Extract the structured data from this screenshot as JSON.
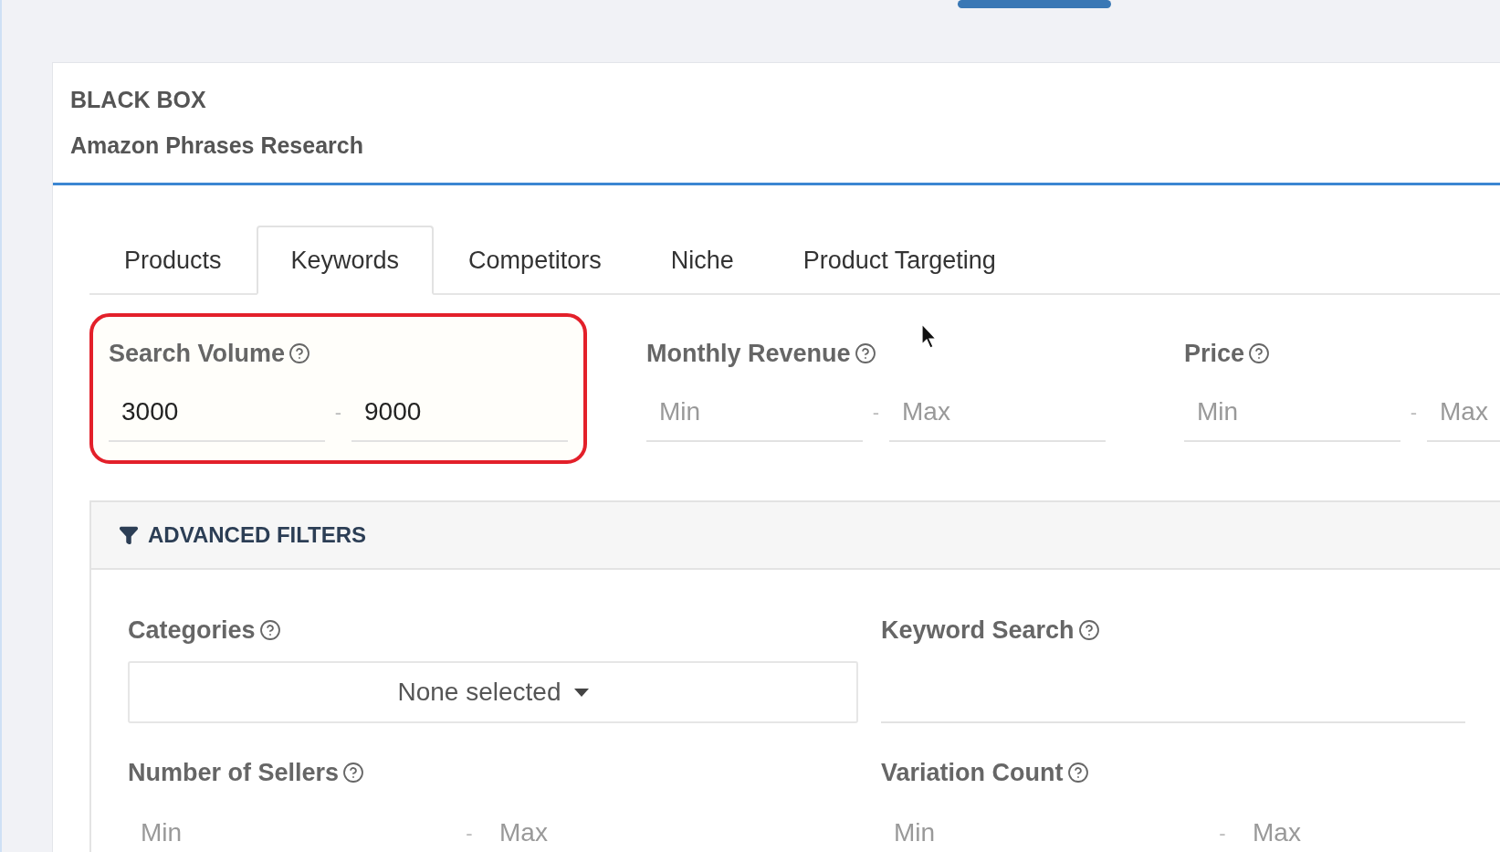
{
  "header": {
    "title": "BLACK BOX",
    "subtitle": "Amazon Phrases Research"
  },
  "tabs": [
    {
      "label": "Products",
      "selected": false
    },
    {
      "label": "Keywords",
      "selected": true
    },
    {
      "label": "Competitors",
      "selected": false
    },
    {
      "label": "Niche",
      "selected": false
    },
    {
      "label": "Product Targeting",
      "selected": false
    }
  ],
  "filters": [
    {
      "label": "Search Volume",
      "highlighted": true,
      "min": {
        "value": "3000"
      },
      "separator": "-",
      "max": {
        "value": "9000"
      }
    },
    {
      "label": "Monthly Revenue",
      "highlighted": false,
      "min": {
        "placeholder": "Min"
      },
      "separator": "-",
      "max": {
        "placeholder": "Max"
      }
    },
    {
      "label": "Price",
      "highlighted": false,
      "min": {
        "placeholder": "Min"
      },
      "separator": "-",
      "max": {
        "placeholder": "Max"
      }
    }
  ],
  "advanced_filters": {
    "title": "ADVANCED FILTERS",
    "fields": [
      {
        "kind": "dropdown",
        "label": "Categories",
        "value": "None selected"
      },
      {
        "kind": "text",
        "label": "Keyword Search"
      },
      {
        "kind": "range",
        "label": "Number of Sellers",
        "min": {
          "placeholder": "Min"
        },
        "separator": "-",
        "max": {
          "placeholder": "Max"
        }
      },
      {
        "kind": "range",
        "label": "Variation Count",
        "min": {
          "placeholder": "Min"
        },
        "separator": "-",
        "max": {
          "placeholder": "Max"
        }
      }
    ]
  }
}
